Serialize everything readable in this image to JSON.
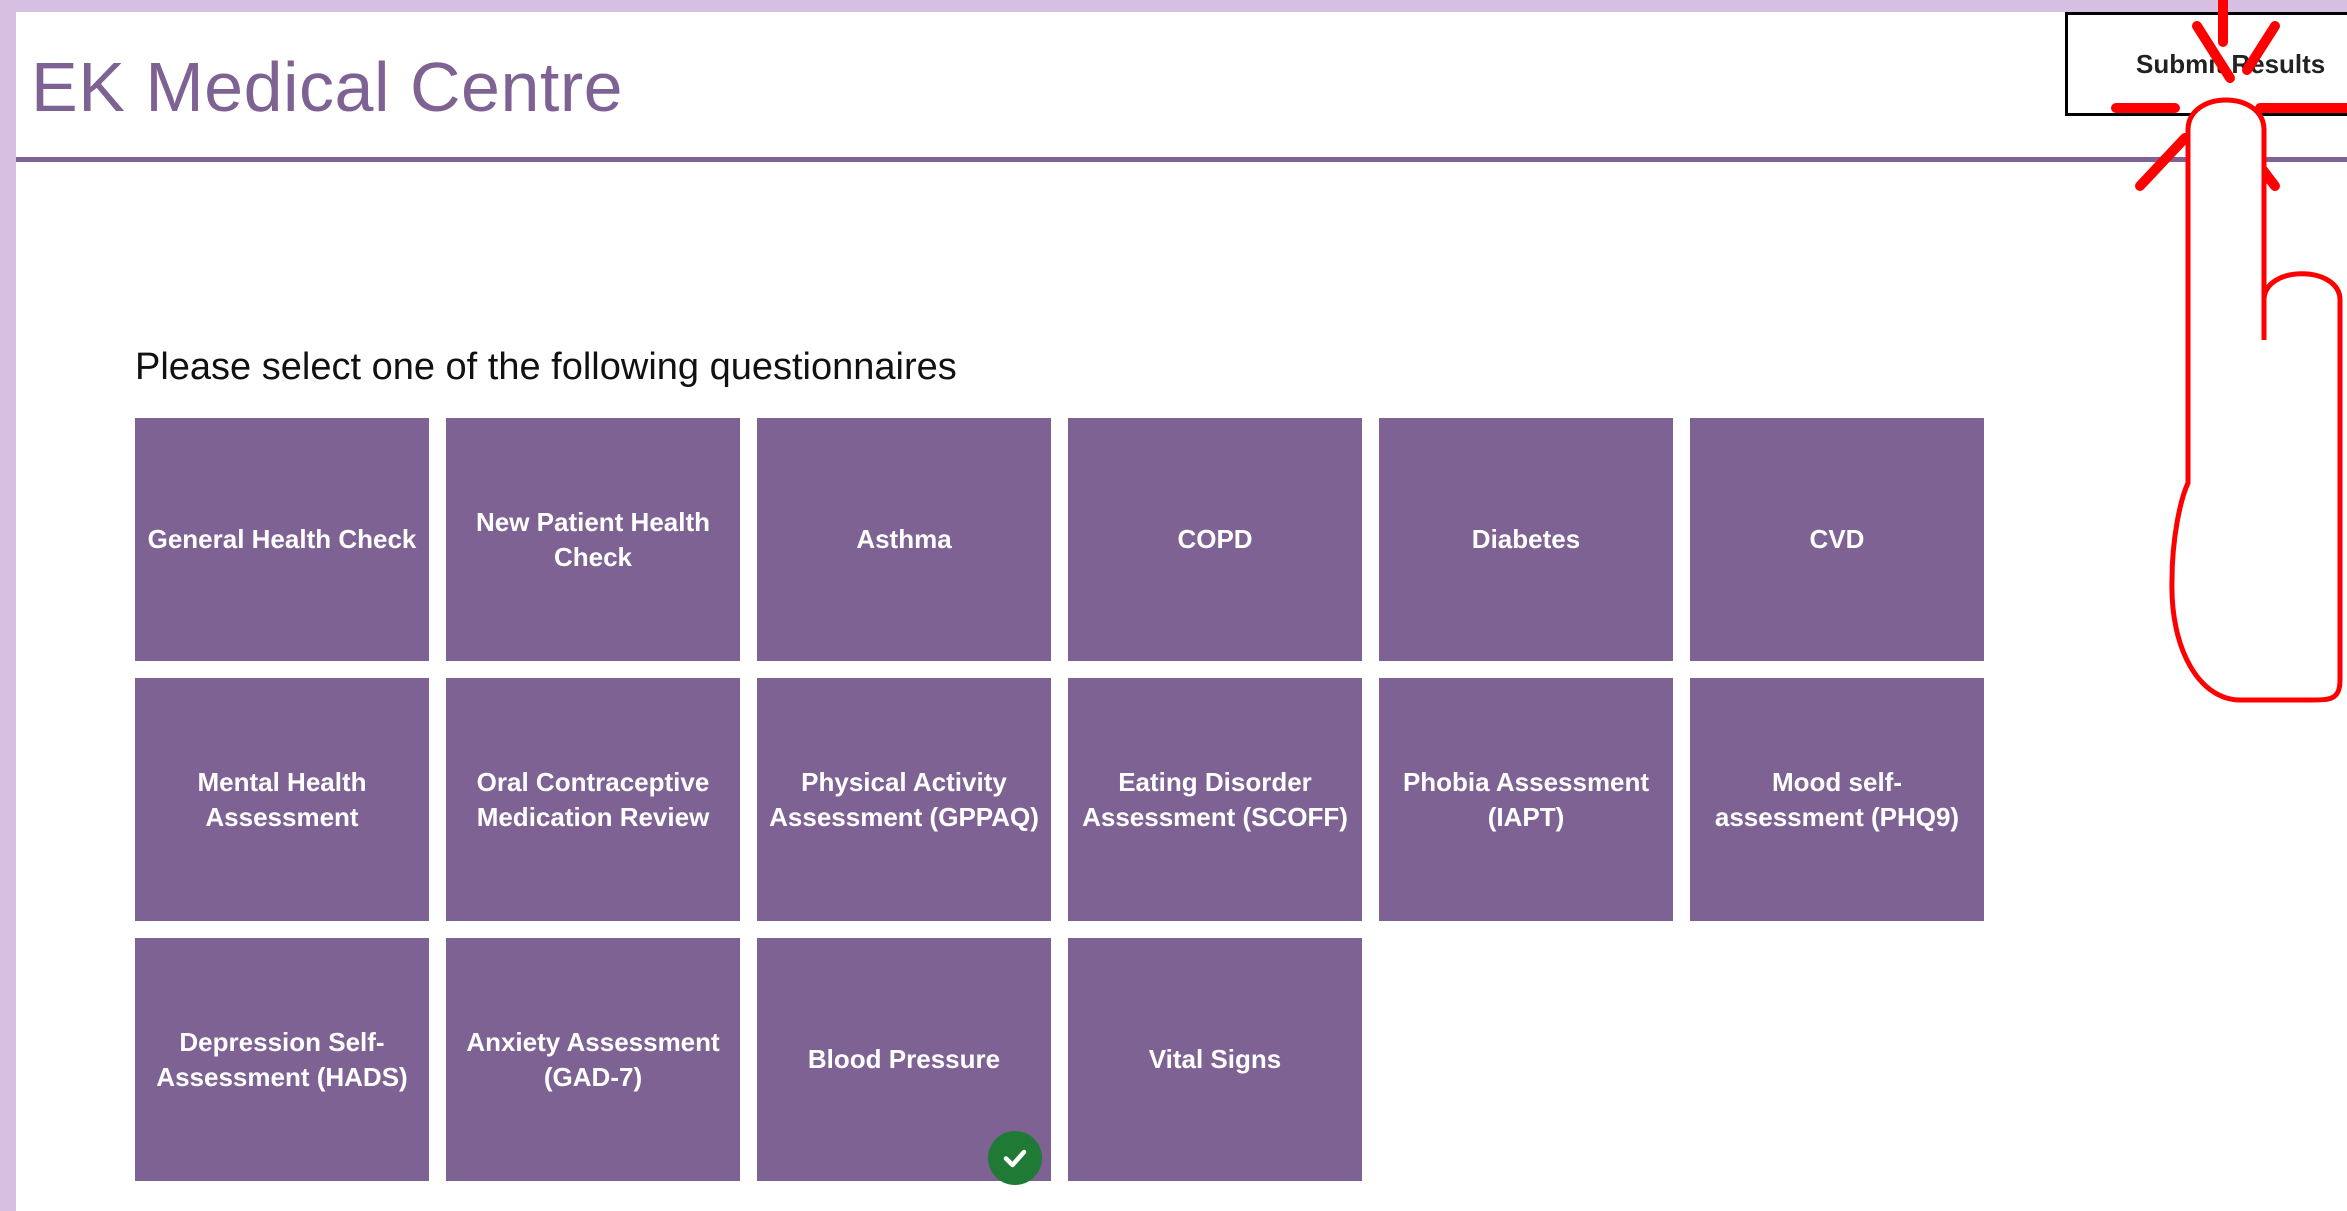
{
  "header": {
    "title": "EK Medical Centre",
    "submit_label": "Submit Results"
  },
  "main": {
    "prompt": "Please select one of the following questionnaires",
    "questionnaires": [
      {
        "label": "General Health Check",
        "completed": false
      },
      {
        "label": "New Patient Health Check",
        "completed": false
      },
      {
        "label": "Asthma",
        "completed": false
      },
      {
        "label": "COPD",
        "completed": false
      },
      {
        "label": "Diabetes",
        "completed": false
      },
      {
        "label": "CVD",
        "completed": false
      },
      {
        "label": "Mental Health Assessment",
        "completed": false
      },
      {
        "label": "Oral Contraceptive Medication Review",
        "completed": false
      },
      {
        "label": "Physical Activity Assessment (GPPAQ)",
        "completed": false
      },
      {
        "label": "Eating Disorder Assessment (SCOFF)",
        "completed": false
      },
      {
        "label": "Phobia Assessment (IAPT)",
        "completed": false
      },
      {
        "label": "Mood self-assessment (PHQ9)",
        "completed": false
      },
      {
        "label": "Depression Self-Assessment (HADS)",
        "completed": false
      },
      {
        "label": "Anxiety Assessment (GAD-7)",
        "completed": false
      },
      {
        "label": "Blood Pressure",
        "completed": true
      },
      {
        "label": "Vital Signs",
        "completed": false
      }
    ]
  },
  "colors": {
    "accent": "#7e6294",
    "outer_border": "#d7bfe2",
    "completed_badge": "#1f7a35",
    "touch_indicator": "#ff0000"
  },
  "icons": {
    "completed": "check-circle-icon",
    "touch_overlay": "tap-hand-icon"
  }
}
